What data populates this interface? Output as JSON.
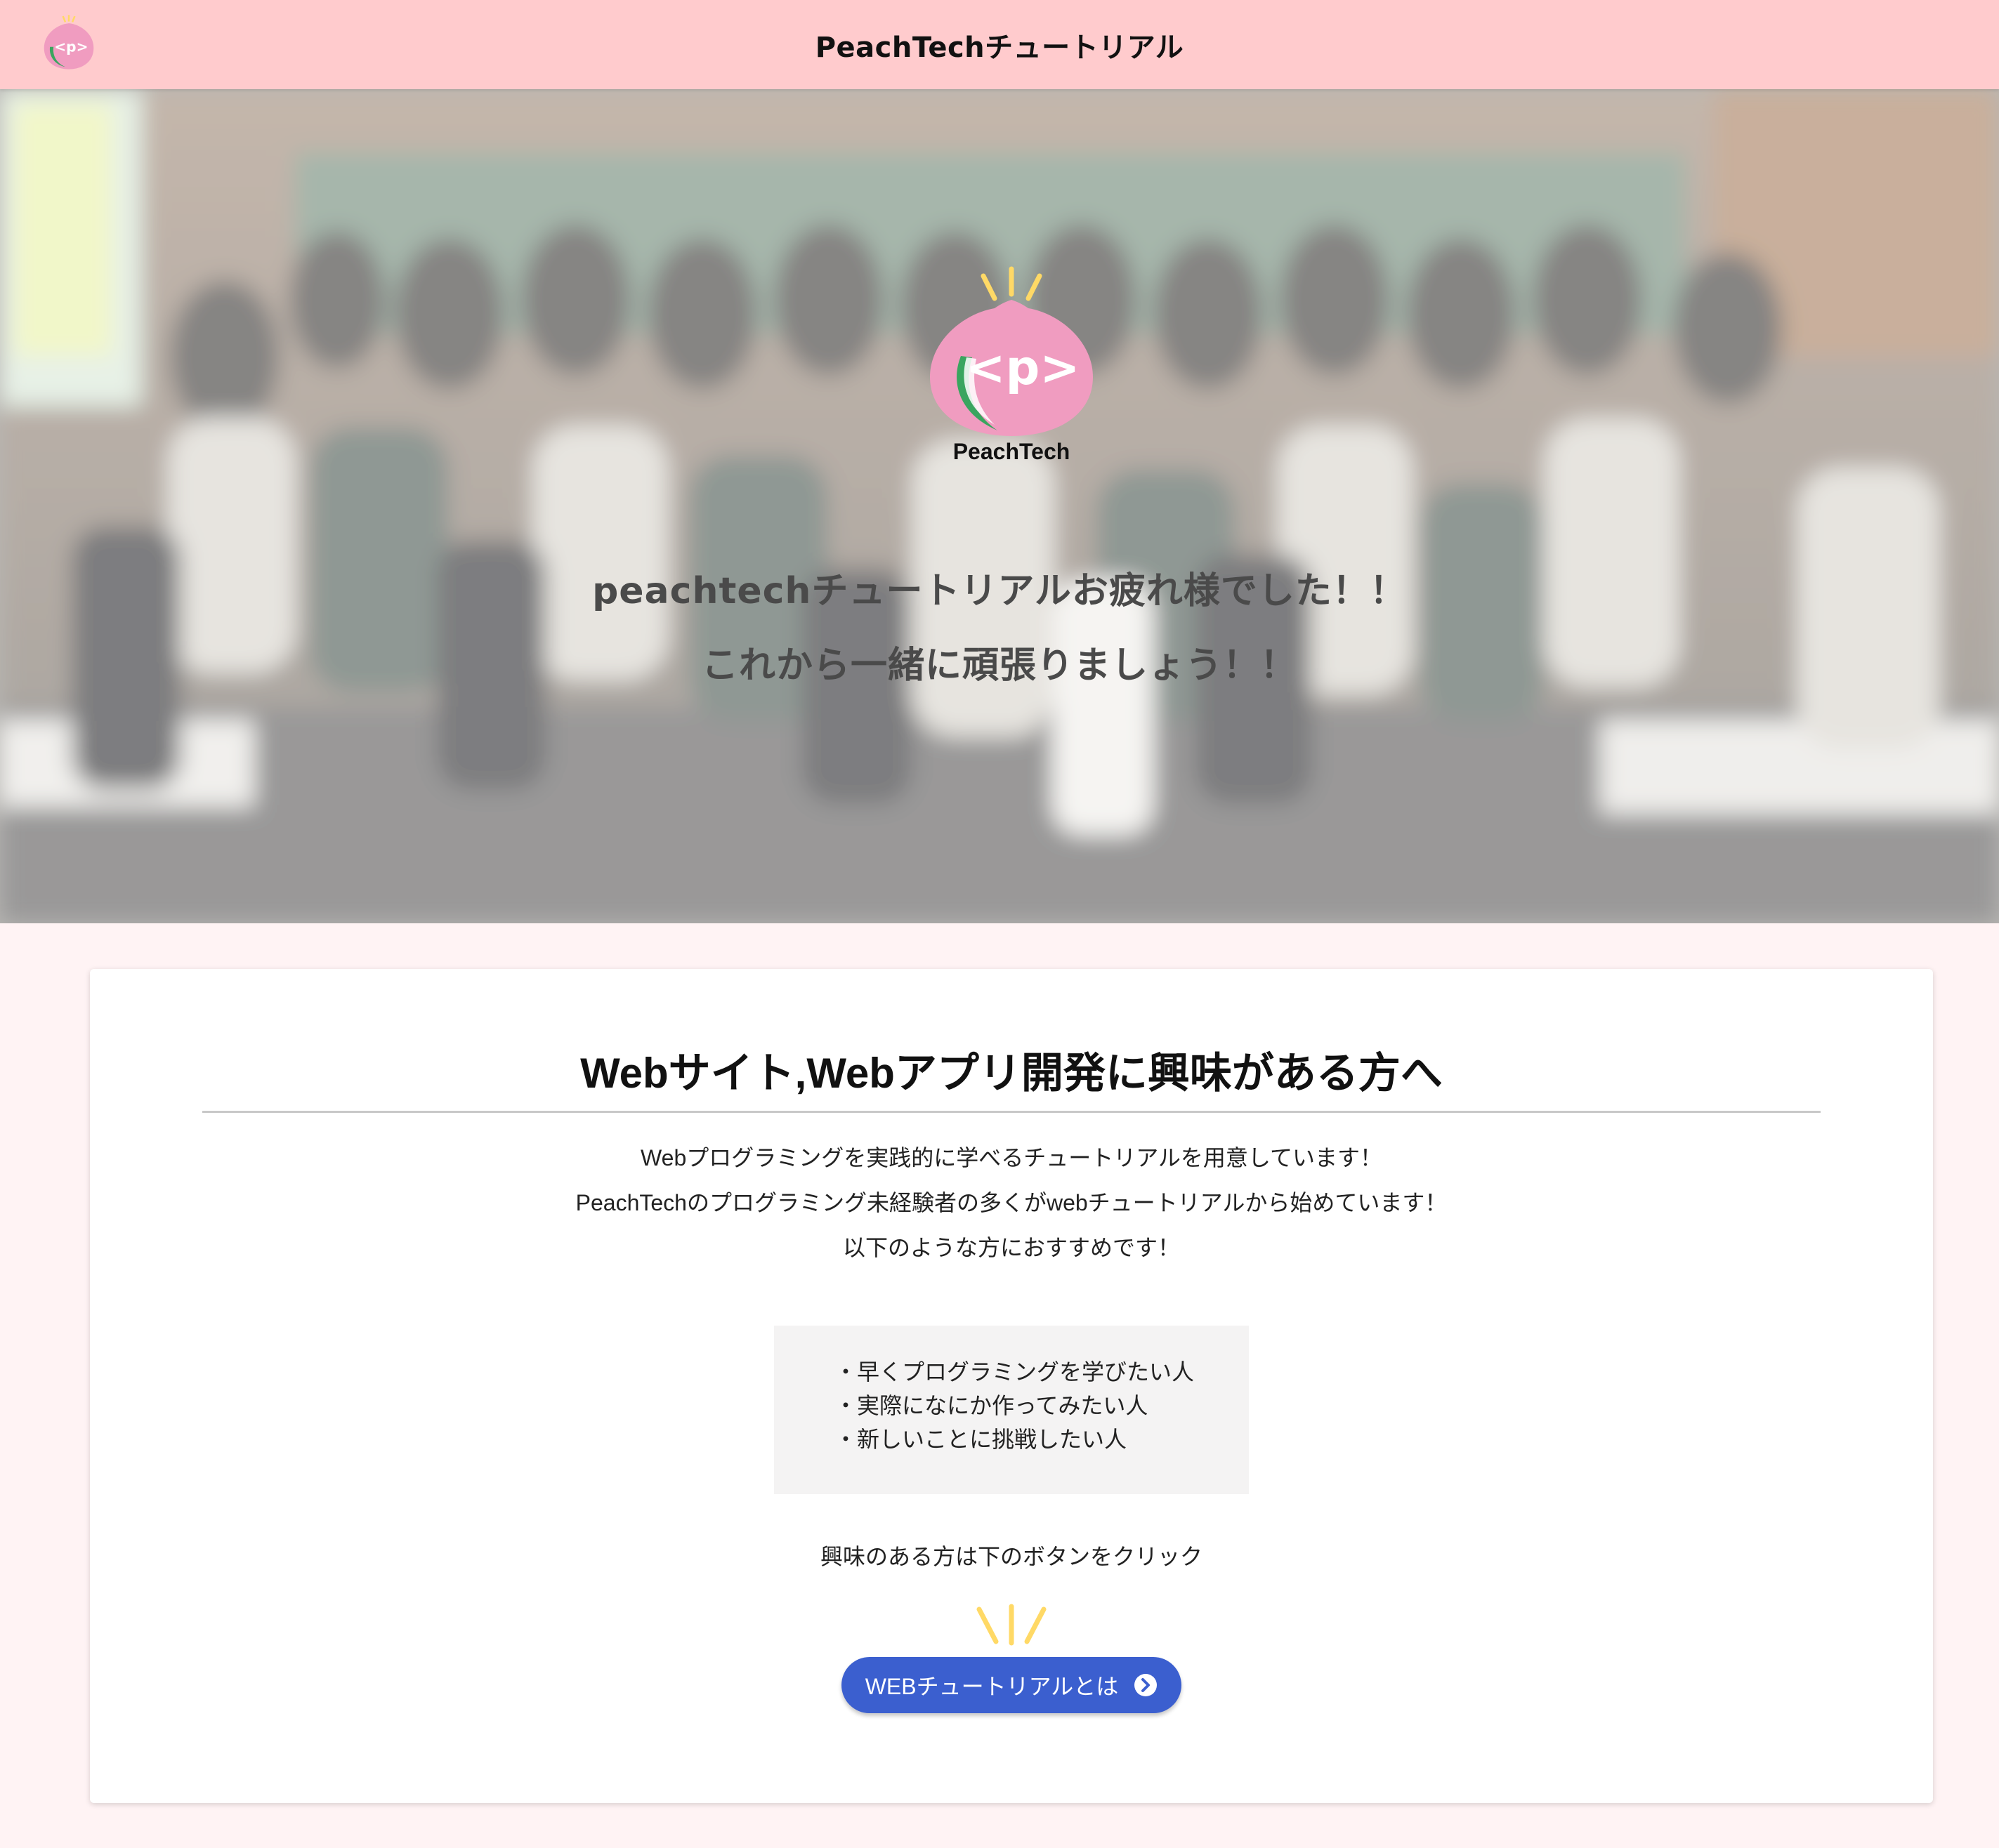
{
  "header": {
    "title": "PeachTechチュートリアル",
    "logo_icon": "peachtech-logo-icon"
  },
  "hero": {
    "logo_icon": "peachtech-peach-logo-icon",
    "logo_glyph": "<p>",
    "logo_text": "PeachTech",
    "line1": "peachtechチュートリアルお疲れ様でした！！",
    "line2": "これから一緒に頑張りましょう！！"
  },
  "card": {
    "title": "Webサイト,Webアプリ開発に興味がある方へ",
    "description": [
      "Webプログラミングを実践的に学べるチュートリアルを用意しています！",
      "PeachTechのプログラミング未経験者の多くがwebチュートリアルから始めています！",
      "以下のような方におすすめです！"
    ],
    "recommendations": [
      "・早くプログラミングを学びたい人",
      "・実際になにか作ってみたい人",
      "・新しいことに挑戦したい人"
    ],
    "cta_text": "興味のある方は下のボタンをクリック",
    "button_label": "WEBチュートリアルとは",
    "button_icon": "chevron-right-circle-icon"
  },
  "colors": {
    "header_bg": "#ffcbcd",
    "page_bg": "#fff3f4",
    "peach": "#f09cc0",
    "leaf": "#3aa55f",
    "sparkle": "#ffd966",
    "button": "#3b5fcf"
  }
}
